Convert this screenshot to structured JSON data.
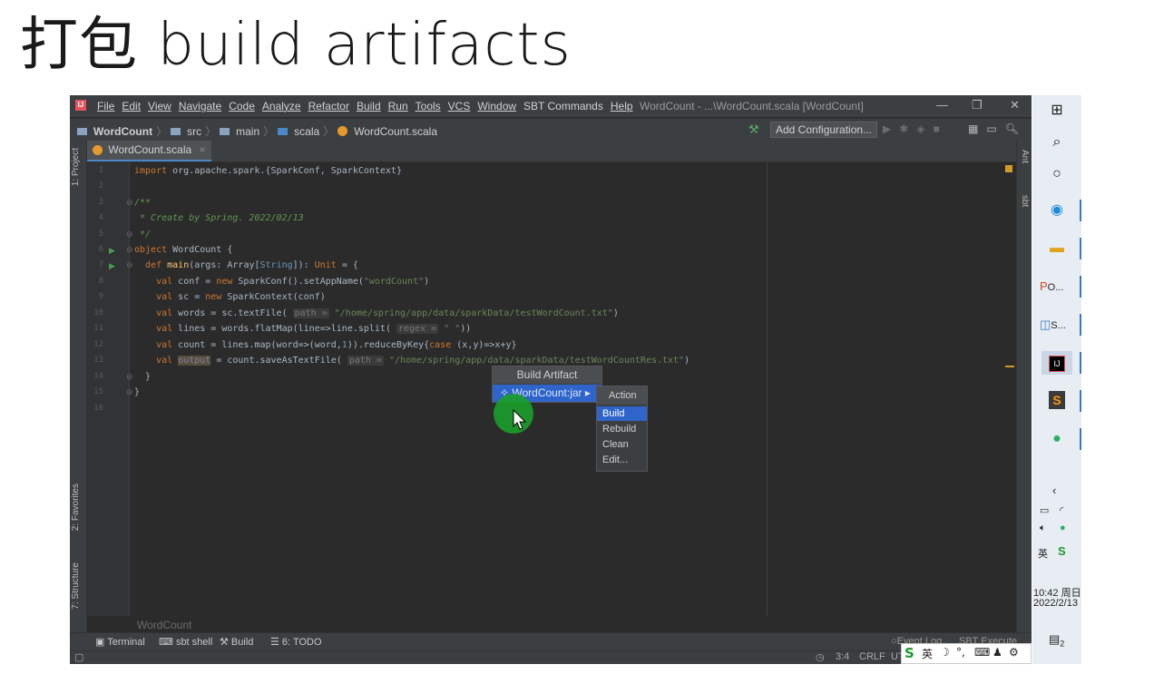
{
  "slide": {
    "title": "打包 build artifacts"
  },
  "ide": {
    "menu": [
      "File",
      "Edit",
      "View",
      "Navigate",
      "Code",
      "Analyze",
      "Refactor",
      "Build",
      "Run",
      "Tools",
      "VCS",
      "Window",
      "SBT Commands",
      "Help"
    ],
    "window_title": "WordCount - ...\\WordCount.scala [WordCount]",
    "breadcrumbs": {
      "project": "WordCount",
      "src": "src",
      "main": "main",
      "scala": "scala",
      "file": "WordCount.scala"
    },
    "add_configuration": "Add Configuration...",
    "tab": {
      "label": "WordCount.scala",
      "close": "×"
    },
    "left_tabs": {
      "project": "1: Project",
      "favorites": "2: Favorites",
      "structure": "7: Structure"
    },
    "right_tabs": {
      "ant": "Ant",
      "sbt": "sbt"
    },
    "code": {
      "line_numbers": [
        "1",
        "2",
        "3",
        "4",
        "5",
        "6",
        "7",
        "8",
        "9",
        "10",
        "11",
        "12",
        "13",
        "14",
        "15",
        "16"
      ],
      "l1_kw": "import",
      "l1_rest": " org.apache.spark.{SparkConf, SparkContext}",
      "l3": "/**",
      "l4": " * Create by Spring. 2022/02/13",
      "l5": " */",
      "l6_kw": "object",
      "l6_rest": " WordCount {",
      "l7_kw": "def ",
      "l7_fn": "main",
      "l7_a": "(args: Array[",
      "l7_ty": "String",
      "l7_b": "]): ",
      "l7_kw2": "Unit",
      "l7_c": " = {",
      "l8_kw": "val",
      "l8_a": " conf = ",
      "l8_kw2": "new",
      "l8_b": " SparkConf().setAppName(",
      "l8_str": "\"wordCount\"",
      "l8_c": ")",
      "l9_kw": "val",
      "l9_a": " sc = ",
      "l9_kw2": "new",
      "l9_b": " SparkContext(conf)",
      "l10_kw": "val",
      "l10_a": " words = sc.textFile( ",
      "l10_hint": "path =",
      "l10_str": " \"/home/spring/app/data/sparkData/testWordCount.txt\"",
      "l10_b": ")",
      "l11_kw": "val",
      "l11_a": " lines = words.flatMap(line=>line.split( ",
      "l11_hint": "regex =",
      "l11_str": " \" \"",
      "l11_b": "))",
      "l12_kw": "val",
      "l12_a": " count = lines.map(word=>(word,",
      "l12_num": "1",
      "l12_b": ")).reduceByKey{",
      "l12_kw2": "case",
      "l12_c": " (x,y)=>x+y}",
      "l13_kw": "val",
      "l13_var": "output",
      "l13_a": " = count.saveAsTextFile( ",
      "l13_hint": "path =",
      "l13_str": " \"/home/spring/app/data/sparkData/testWordCountRes.txt\"",
      "l13_b": ")",
      "l14": "}",
      "l15": "}"
    },
    "breadcrumb_footer": "WordCount",
    "bottom_tabs": {
      "terminal": "Terminal",
      "sbt_shell": "sbt shell",
      "build": "Build",
      "todo": "6: TODO"
    },
    "event_log": "Event Log",
    "sbt_execute": "SBT Execute",
    "status": {
      "position": "3:4",
      "line_sep": "CRLF",
      "encoding": "UT"
    },
    "popup": {
      "title": "Build Artifact",
      "artifact": "WordCount:jar",
      "action_title": "Action",
      "actions": [
        "Build",
        "Rebuild",
        "Clean",
        "Edit..."
      ],
      "selected_action": "Build"
    }
  },
  "taskbar": {
    "items": [
      {
        "label": "O..."
      },
      {
        "label": "S..."
      }
    ],
    "time": "10:42 周日",
    "date": "2022/2/13",
    "ime_label": "英",
    "notification_count": "2",
    "ime_input": "英"
  },
  "colors": {
    "accent": "#2f65ca",
    "cursor_highlight": "#1a9c2a",
    "editor_bg": "#2b2b2b"
  }
}
